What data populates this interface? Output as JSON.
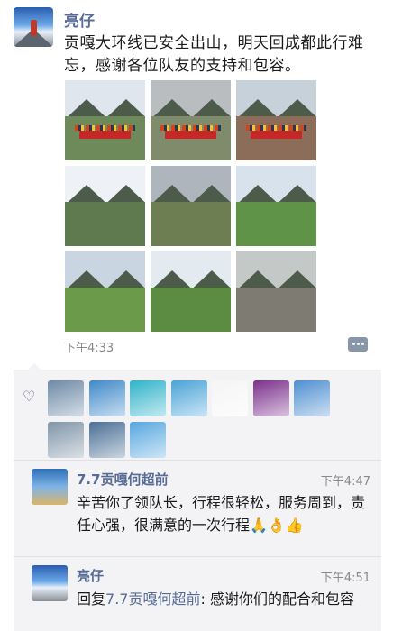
{
  "post": {
    "author": "亮仔",
    "text": "贡嘎大环线已安全出山，明天回成都此行难忘，感谢各位队友的支持和包容。",
    "time": "下午4:33",
    "photos": [
      {
        "sky": "#dfe6ee",
        "ground": "#6f8a5a",
        "banner": true
      },
      {
        "sky": "#b9bdc0",
        "ground": "#7f8b6b",
        "banner": true
      },
      {
        "sky": "#c7d1da",
        "ground": "#8c6d5a",
        "banner": true
      },
      {
        "sky": "#eef2f6",
        "ground": "#5e7a4e",
        "banner": false
      },
      {
        "sky": "#aeb5bd",
        "ground": "#6d7f52",
        "banner": false
      },
      {
        "sky": "#d8e2ec",
        "ground": "#5f9448",
        "banner": false
      },
      {
        "sky": "#c9d6e2",
        "ground": "#6b9a4a",
        "banner": false
      },
      {
        "sky": "#e4ebf0",
        "ground": "#5c8c42",
        "banner": false
      },
      {
        "sky": "#c4c8c7",
        "ground": "#7e7b72",
        "banner": false
      }
    ]
  },
  "likes": {
    "avatars": [
      "#6d8aa6",
      "#3f89c9",
      "#2fb3c9",
      "#4aa3d8",
      "#f5f5f5",
      "#7b2f8c",
      "#4f8fd1",
      "#8095a8",
      "#4a6f95",
      "#56a7e0"
    ]
  },
  "comments": [
    {
      "name": "7.7贡嘎何超前",
      "time": "下午4:47",
      "text": "辛苦你了领队长，行程很轻松，服务周到，责任心强，很满意的一次行程🙏👌👍"
    },
    {
      "name": "亮仔",
      "time": "下午4:51",
      "reply_prefix": "回复",
      "reply_to": "7.7贡嘎何超前",
      "text": ": 感谢你们的配合和包容"
    }
  ]
}
